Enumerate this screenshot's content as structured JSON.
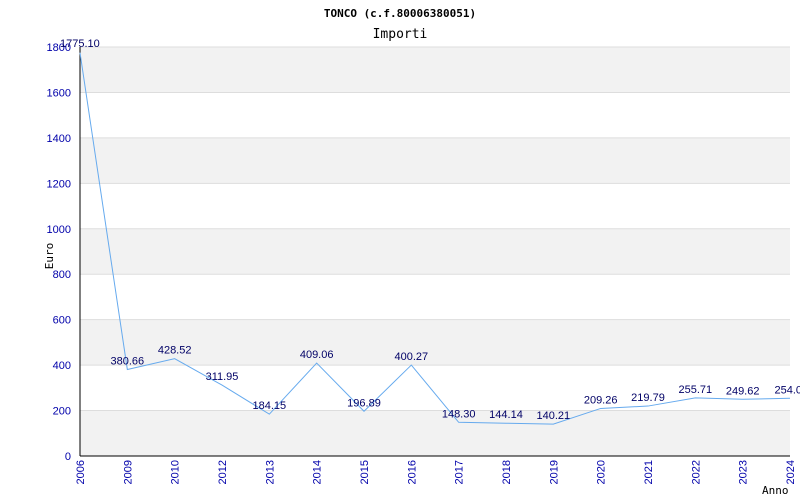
{
  "chart_data": {
    "type": "line",
    "title": "TONCO (c.f.80006380051)",
    "subtitle": "Importi",
    "xlabel": "Anno",
    "ylabel": "Euro",
    "categories": [
      "2006",
      "2009",
      "2010",
      "2012",
      "2013",
      "2014",
      "2015",
      "2016",
      "2017",
      "2018",
      "2019",
      "2020",
      "2021",
      "2022",
      "2023",
      "2024"
    ],
    "values": [
      1775.1,
      380.66,
      428.52,
      311.95,
      184.15,
      409.06,
      196.89,
      400.27,
      148.3,
      144.14,
      140.21,
      209.26,
      219.79,
      255.71,
      249.62,
      254.0
    ],
    "data_labels": [
      "1775.10",
      "380.66",
      "428.52",
      "311.95",
      "184.15",
      "409.06",
      "196.89",
      "400.27",
      "148.30",
      "144.14",
      "140.21",
      "209.26",
      "219.79",
      "255.71",
      "249.62",
      "254.0"
    ],
    "ylim": [
      0,
      1800
    ],
    "yticks": [
      0,
      200,
      400,
      600,
      800,
      1000,
      1200,
      1400,
      1600,
      1800
    ],
    "grid": true,
    "legend": "none",
    "colors": {
      "line": "#66aaee",
      "band": "#f2f2f2",
      "grid": "#dddddd",
      "tick_text": "#0000aa",
      "label_text": "#000066"
    }
  }
}
